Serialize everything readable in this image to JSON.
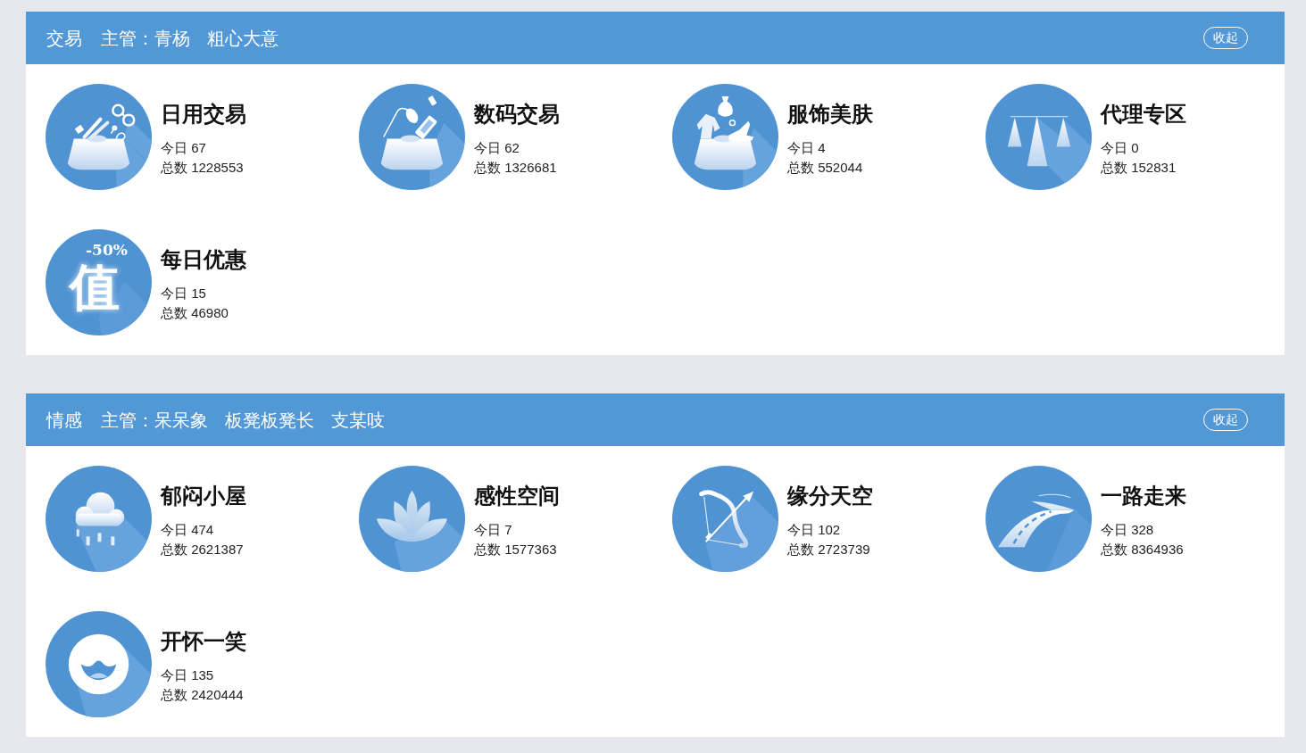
{
  "sections": [
    {
      "title": "交易",
      "manager_label": "主管：",
      "managers": [
        "青杨",
        "粗心大意"
      ],
      "collapse_button": "收起",
      "boards": [
        {
          "kind": "sundries",
          "name": "日用交易",
          "today": "今日 67",
          "total": "总数 1228553"
        },
        {
          "kind": "digital",
          "name": "数码交易",
          "today": "今日 62",
          "total": "总数 1326681"
        },
        {
          "kind": "fashion",
          "name": "服饰美肤",
          "today": "今日 4",
          "total": "总数 552044"
        },
        {
          "kind": "cones",
          "name": "代理专区",
          "today": "今日 0",
          "total": "总数 152831"
        },
        {
          "kind": "discount",
          "name": "每日优惠",
          "icon_texts": [
            "-50%",
            "值"
          ],
          "today": "今日 15",
          "total": "总数 46980"
        }
      ]
    },
    {
      "title": "情感",
      "manager_label": "主管：",
      "managers": [
        "呆呆象",
        "板凳板凳长",
        "支某吱"
      ],
      "collapse_button": "收起",
      "boards": [
        {
          "kind": "rain",
          "name": "郁闷小屋",
          "today": "今日 474",
          "total": "总数 2621387"
        },
        {
          "kind": "lotus",
          "name": "感性空间",
          "today": "今日 7",
          "total": "总数 1577363"
        },
        {
          "kind": "bow",
          "name": "缘分天空",
          "today": "今日 102",
          "total": "总数 2723739"
        },
        {
          "kind": "road",
          "name": "一路走来",
          "today": "今日 328",
          "total": "总数 8364936"
        },
        {
          "kind": "smile",
          "name": "开怀一笑",
          "today": "今日 135",
          "total": "总数 2420444"
        }
      ]
    }
  ]
}
